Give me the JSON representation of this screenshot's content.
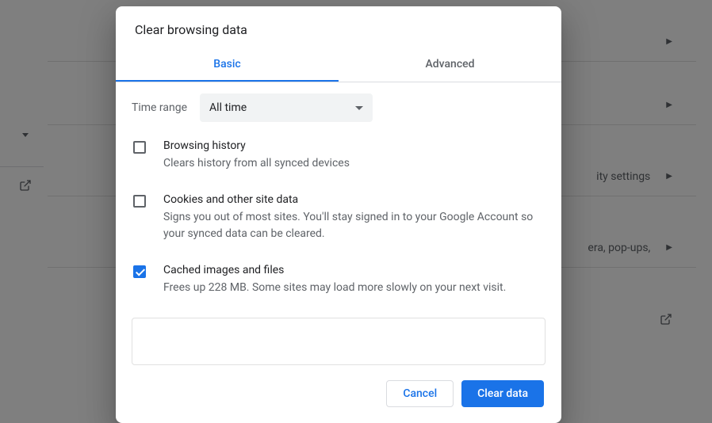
{
  "background": {
    "row2_text": "ity settings",
    "row3_text": "era, pop-ups,"
  },
  "dialog": {
    "title": "Clear browsing data",
    "tabs": {
      "basic": "Basic",
      "advanced": "Advanced"
    },
    "time_range": {
      "label": "Time range",
      "selected": "All time"
    },
    "options": {
      "browsing": {
        "checked": false,
        "title": "Browsing history",
        "desc": "Clears history from all synced devices"
      },
      "cookies": {
        "checked": false,
        "title": "Cookies and other site data",
        "desc": "Signs you out of most sites. You'll stay signed in to your Google Account so your synced data can be cleared."
      },
      "cache": {
        "checked": true,
        "title": "Cached images and files",
        "desc": "Frees up 228 MB. Some sites may load more slowly on your next visit."
      }
    },
    "buttons": {
      "cancel": "Cancel",
      "confirm": "Clear data"
    }
  }
}
